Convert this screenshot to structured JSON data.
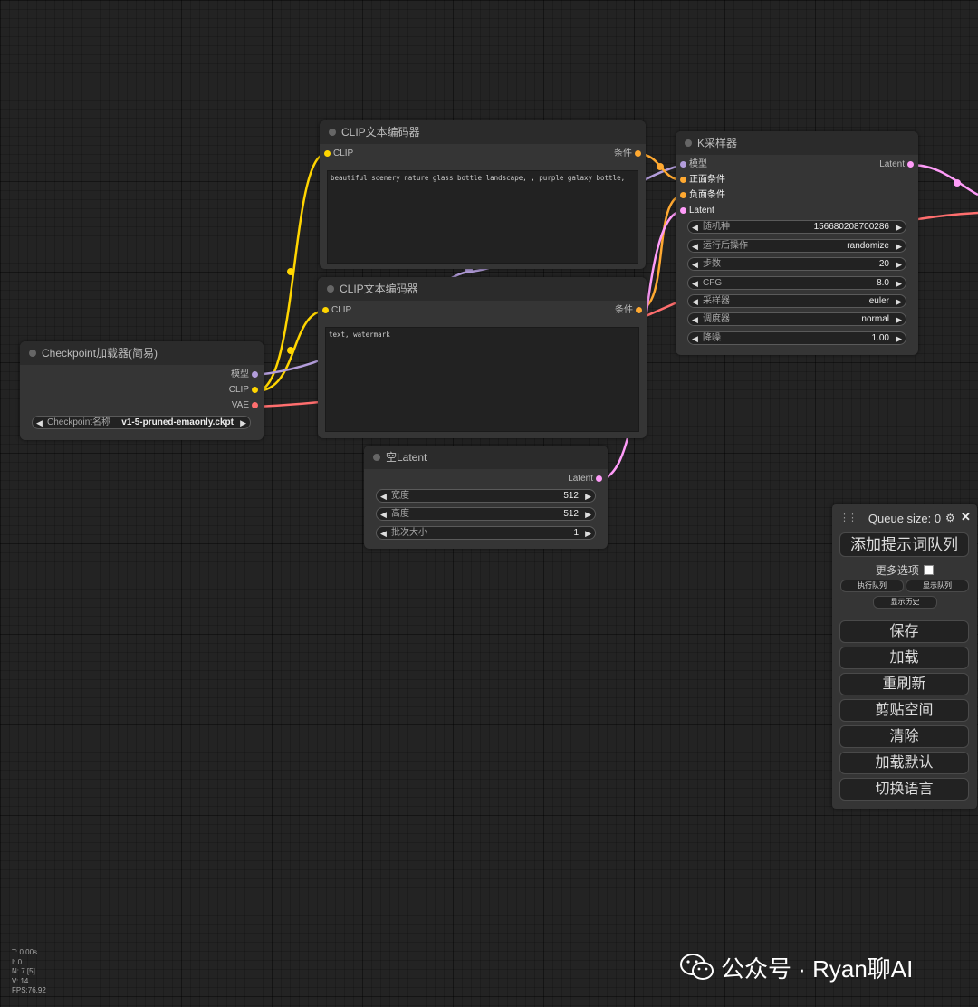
{
  "nodes": {
    "checkpoint": {
      "title": "Checkpoint加载器(简易)",
      "outputs": [
        "模型",
        "CLIP",
        "VAE"
      ],
      "widget": {
        "label": "Checkpoint名称",
        "value": "v1-5-pruned-emaonly.ckpt"
      }
    },
    "clip_positive": {
      "title": "CLIP文本编码器",
      "input": "CLIP",
      "output": "条件",
      "text": "beautiful scenery nature glass bottle landscape, , purple galaxy bottle,"
    },
    "clip_negative": {
      "title": "CLIP文本编码器",
      "input": "CLIP",
      "output": "条件",
      "text": "text, watermark"
    },
    "empty_latent": {
      "title": "空Latent",
      "output": "Latent",
      "widgets": [
        {
          "label": "宽度",
          "value": "512"
        },
        {
          "label": "高度",
          "value": "512"
        },
        {
          "label": "批次大小",
          "value": "1"
        }
      ]
    },
    "ksampler": {
      "title": "K采样器",
      "inputs": [
        "模型",
        "正面条件",
        "负面条件",
        "Latent"
      ],
      "output": "Latent",
      "widgets": [
        {
          "label": "随机种",
          "value": "156680208700286"
        },
        {
          "label": "运行后操作",
          "value": "randomize"
        },
        {
          "label": "步数",
          "value": "20"
        },
        {
          "label": "CFG",
          "value": "8.0"
        },
        {
          "label": "采样器",
          "value": "euler"
        },
        {
          "label": "调度器",
          "value": "normal"
        },
        {
          "label": "降噪",
          "value": "1.00"
        }
      ]
    }
  },
  "queue_panel": {
    "title": "Queue size: 0",
    "add_prompt": "添加提示词队列",
    "more_options": "更多选项",
    "view_queue": "执行队列",
    "show_queue": "显示队列",
    "view_history": "显示历史",
    "buttons": [
      "保存",
      "加载",
      "重刷新",
      "剪贴空间",
      "清除",
      "加载默认",
      "切换语言"
    ]
  },
  "stats": [
    "T: 0.00s",
    "I: 0",
    "N: 7 [5]",
    "V: 14",
    "FPS:76.92"
  ],
  "watermark": "公众号 · Ryan聊AI",
  "colors": {
    "clip": "#ffd500",
    "model": "#b39ddb",
    "vae": "#ff6e6e",
    "conditioning": "#ffa931",
    "latent": "#ff9cf9"
  }
}
